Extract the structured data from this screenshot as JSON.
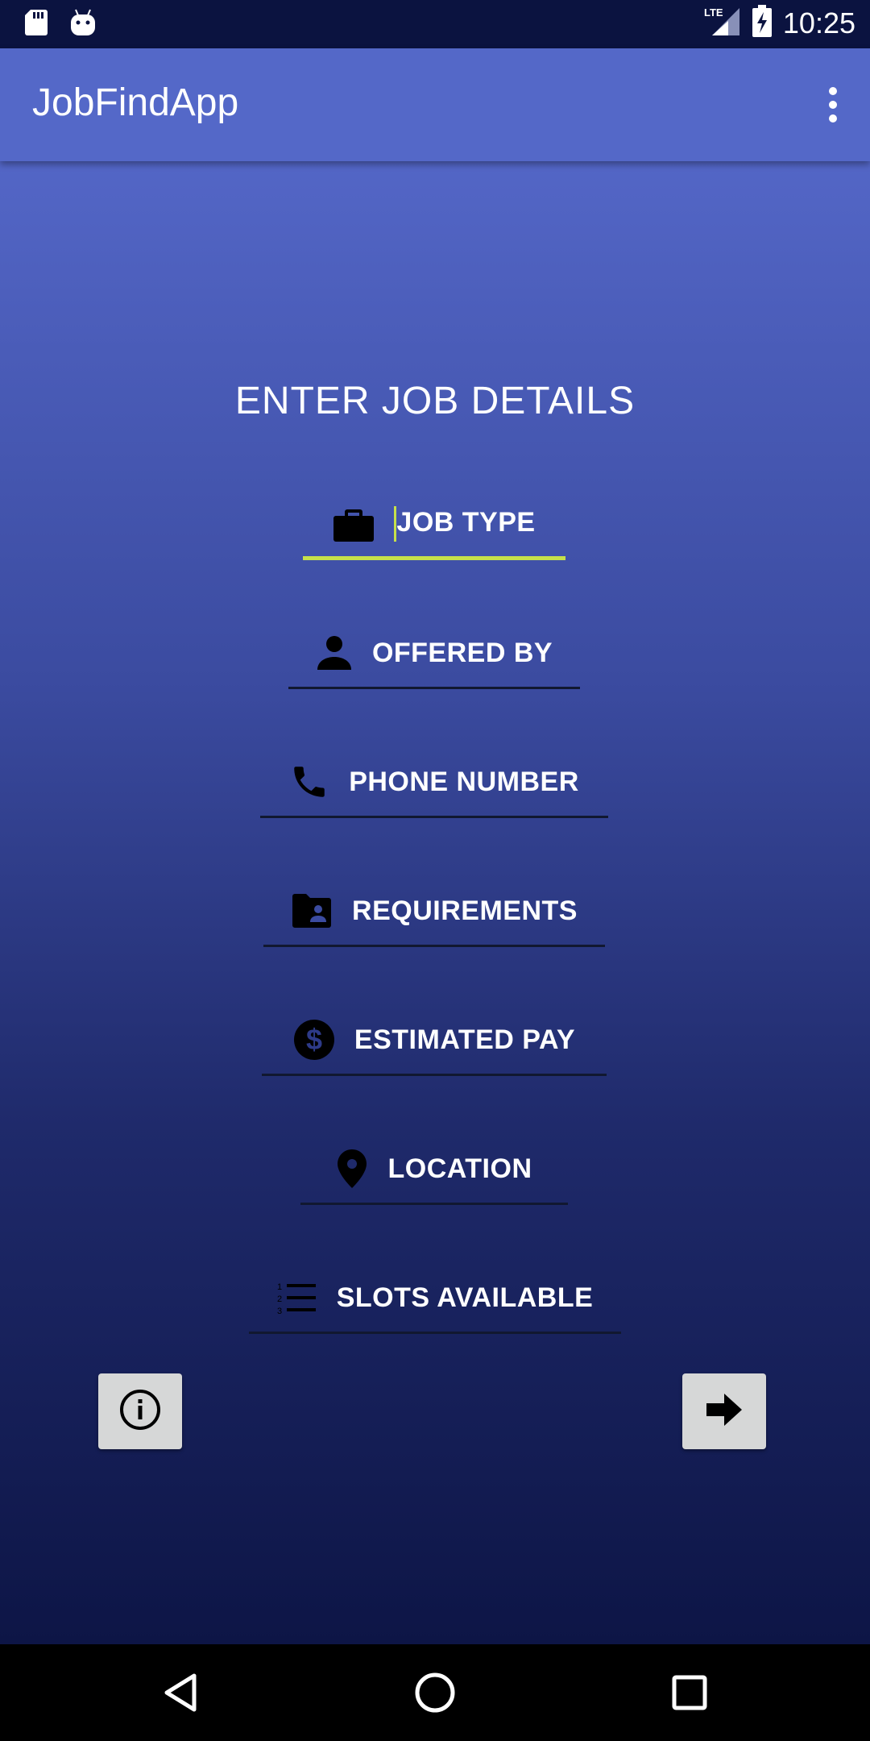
{
  "status_bar": {
    "time": "10:25",
    "network": "LTE"
  },
  "app_bar": {
    "title": "JobFindApp"
  },
  "form": {
    "heading": "ENTER JOB DETAILS",
    "fields": [
      {
        "placeholder": "JOB TYPE",
        "icon": "briefcase-icon"
      },
      {
        "placeholder": "OFFERED BY",
        "icon": "person-icon"
      },
      {
        "placeholder": "PHONE NUMBER",
        "icon": "phone-icon"
      },
      {
        "placeholder": "REQUIREMENTS",
        "icon": "folder-shared-icon"
      },
      {
        "placeholder": "ESTIMATED PAY",
        "icon": "dollar-icon"
      },
      {
        "placeholder": "LOCATION",
        "icon": "location-pin-icon"
      },
      {
        "placeholder": "SLOTS AVAILABLE",
        "icon": "numbered-list-icon"
      }
    ],
    "active_field_accent": "#c6e04a"
  },
  "colors": {
    "app_bar": "#5468c8",
    "status_bar": "#0b1340",
    "button_bg": "#d6d7d7"
  }
}
